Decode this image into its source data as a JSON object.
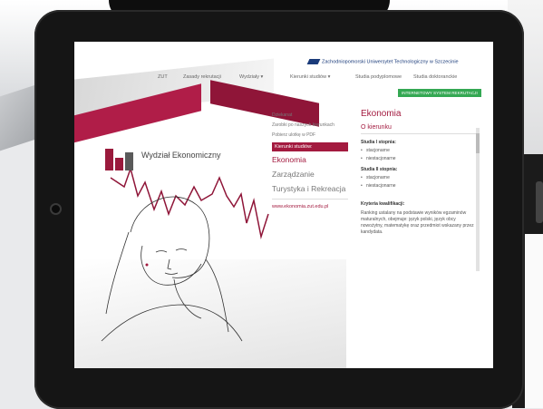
{
  "website": {
    "university": "Zachodniopomorski Uniwersytet Technologiczny w Szczecinie",
    "faculty_logo": "Wydział Ekonomiczny",
    "nav": [
      "ZUT",
      "Zasady rekrutacji",
      "Wydziały ▾",
      "Kierunki studiów ▾",
      "Studia podyplomowe",
      "Studia doktoranckie"
    ],
    "recruit_button": "INTERNETOWY SYSTEM REKRUTACJI",
    "side_menu": {
      "links": [
        "Dziekanat",
        "Zarobki po naszych kierunkach",
        "Pobierz ulotkę w PDF"
      ],
      "active": "Kierunki studiów:",
      "programs": [
        "Ekonomia",
        "Zarządzanie",
        "Turystyka i Rekreacja"
      ],
      "site_link": "www.ekonomia.zut.edu.pl"
    },
    "content": {
      "title": "Ekonomia",
      "subtitle": "O kierunku",
      "section1": "Studia I stopnia:",
      "section1_items": [
        "stacjonarne",
        "niestacjonarne"
      ],
      "section2": "Studia II stopnia:",
      "section2_items": [
        "stacjonarne",
        "niestacjonarne"
      ],
      "section3": "Kryteria kwalifikacji:",
      "paragraph": "Ranking ustalany na podstawie wyników egzaminów maturalnych, obejmuje: język polski, język obcy nowożytny, matematykę oraz przedmiot wskazany przez kandydata."
    }
  },
  "colors": {
    "brand": "#a31a3f",
    "button": "#34a853",
    "uni_blue": "#1a3b7a"
  }
}
